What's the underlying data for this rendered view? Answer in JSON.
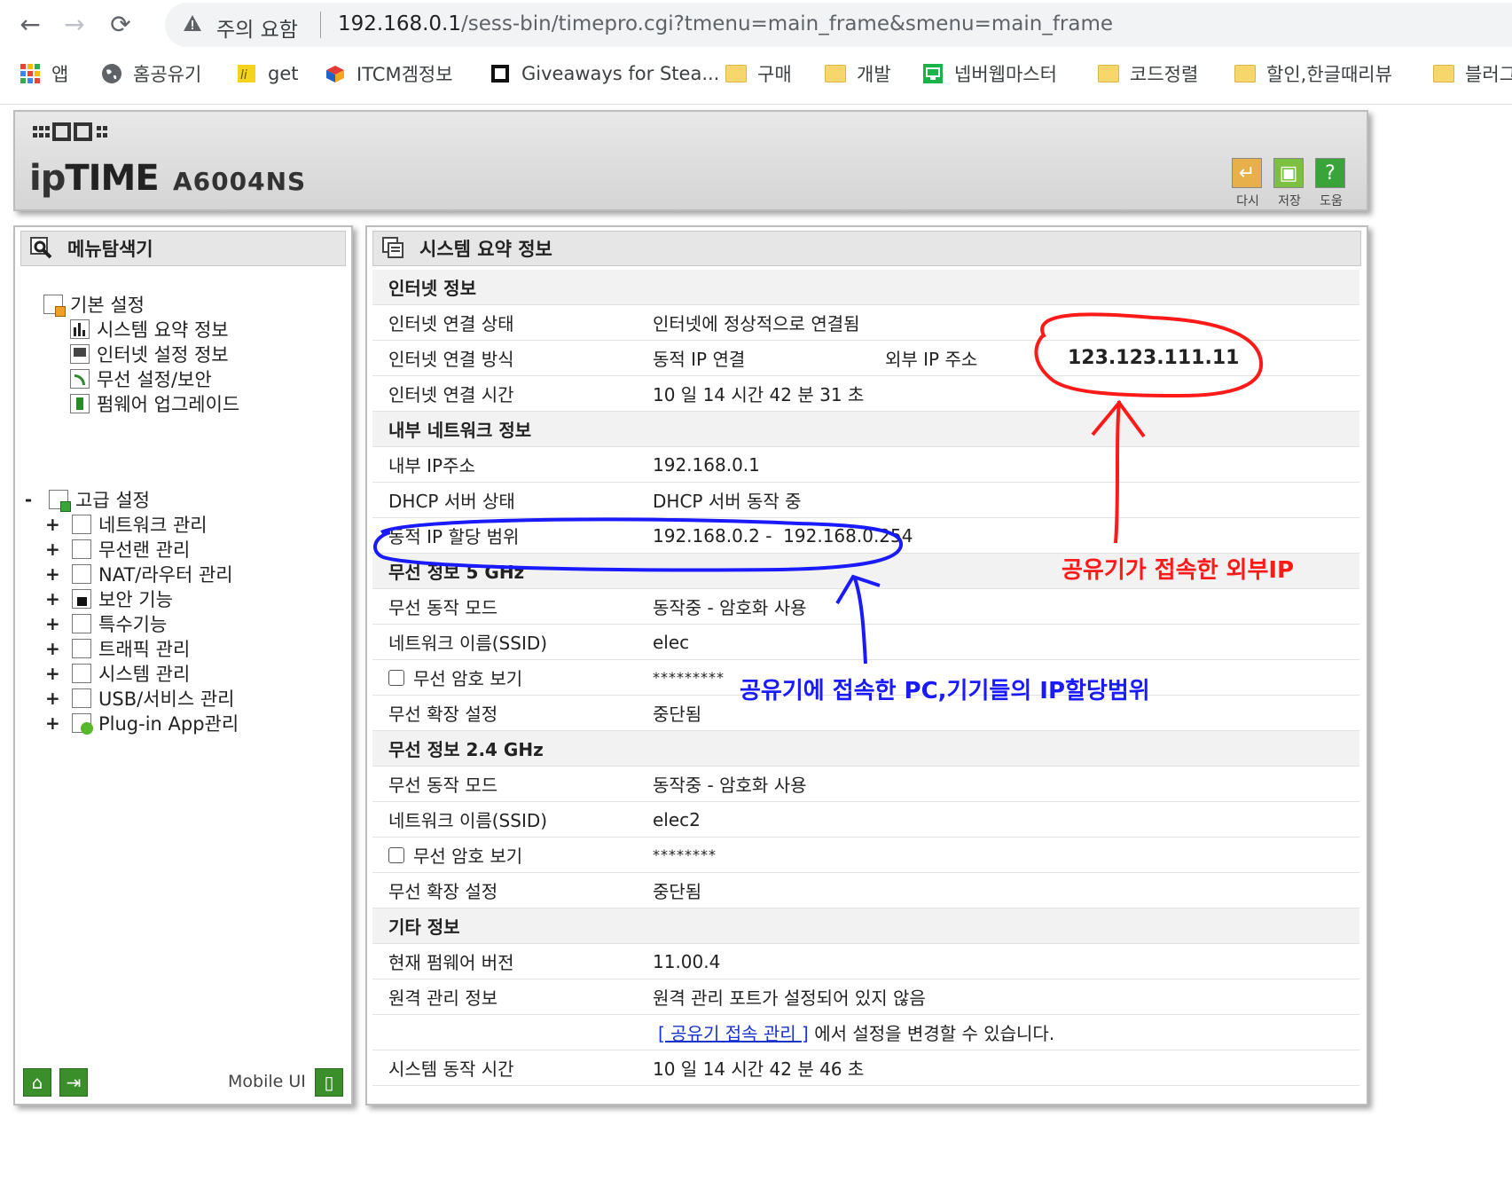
{
  "browser": {
    "nav": {
      "back": "←",
      "forward": "→",
      "reload": "⟳"
    },
    "address": {
      "warning": "주의 요함",
      "host": "192.168.0.1",
      "path": "/sess-bin/timepro.cgi?tmenu=main_frame&smenu=main_frame"
    },
    "bookmarks": [
      {
        "label": "앱",
        "icon": "apps-grid-icon"
      },
      {
        "label": "홈공유기",
        "icon": "globe-icon"
      },
      {
        "label": "get",
        "icon": "bookmark-yellow-icon"
      },
      {
        "label": "ITCM겜정보",
        "icon": "box-icon"
      },
      {
        "label": "Giveaways for Stea...",
        "icon": "square-icon"
      },
      {
        "label": "구매",
        "icon": "folder-icon"
      },
      {
        "label": "개발",
        "icon": "folder-icon"
      },
      {
        "label": "넵버웹마스터",
        "icon": "monitor-icon"
      },
      {
        "label": "코드정렬",
        "icon": "folder-icon"
      },
      {
        "label": "할인,한글때리뷰",
        "icon": "folder-icon"
      },
      {
        "label": "블러그",
        "icon": "folder-icon"
      }
    ]
  },
  "router": {
    "brand_prefix": "ip",
    "brand_suffix": "TIME",
    "model": "A6004NS",
    "header_buttons": [
      {
        "label": "다시",
        "glyph": "↵",
        "color": "#e7b04a"
      },
      {
        "label": "저장",
        "glyph": "▣",
        "color": "#7cc042"
      },
      {
        "label": "도움",
        "glyph": "?",
        "color": "#3aa33a"
      }
    ],
    "menu": {
      "title": "메뉴탐색기",
      "basic_label": "기본 설정",
      "basic_items": [
        "시스템 요약 정보",
        "인터넷 설정 정보",
        "무선 설정/보안",
        "펌웨어 업그레이드"
      ],
      "advanced_toggle": "-",
      "advanced_label": "고급 설정",
      "advanced_items": [
        "네트워크 관리",
        "무선랜 관리",
        "NAT/라우터 관리",
        "보안 기능",
        "특수기능",
        "트래픽 관리",
        "시스템 관리",
        "USB/서비스 관리",
        "Plug-in App관리"
      ],
      "expand_glyph": "+",
      "mobile_label": "Mobile UI"
    },
    "content": {
      "title": "시스템 요약 정보",
      "internet": {
        "section": "인터넷 정보",
        "status_label": "인터넷 연결 상태",
        "status_value": "인터넷에 정상적으로 연결됨",
        "method_label": "인터넷 연결 방식",
        "method_value": "동적 IP 연결",
        "external_ip_label": "외부 IP 주소",
        "external_ip_value": "123.123.111.11",
        "time_label": "인터넷 연결 시간",
        "time_value": "10 일 14 시간 42 분 31 초"
      },
      "lan": {
        "section": "내부 네트워크 정보",
        "ip_label": "내부 IP주소",
        "ip_value": "192.168.0.1",
        "dhcp_label": "DHCP 서버 상태",
        "dhcp_value": "DHCP 서버 동작 중",
        "range_label": "동적 IP 할당 범위",
        "range_value": "192.168.0.2 -  192.168.0.254"
      },
      "wifi5": {
        "section": "무선 정보 5 GHz",
        "mode_label": "무선 동작 모드",
        "mode_value": "동작중 - 암호화 사용",
        "ssid_label": "네트워크 이름(SSID)",
        "ssid_value": "elec",
        "pw_label": "무선 암호 보기",
        "pw_value": "*********",
        "ext_label": "무선 확장 설정",
        "ext_value": "중단됨"
      },
      "wifi24": {
        "section": "무선 정보 2.4 GHz",
        "mode_label": "무선 동작 모드",
        "mode_value": "동작중 - 암호화 사용",
        "ssid_label": "네트워크 이름(SSID)",
        "ssid_value": "elec2",
        "pw_label": "무선 암호 보기",
        "pw_value": "********",
        "ext_label": "무선 확장 설정",
        "ext_value": "중단됨"
      },
      "etc": {
        "section": "기타 정보",
        "fw_label": "현재 펌웨어 버전",
        "fw_value": "11.00.4",
        "remote_label": "원격 관리 정보",
        "remote_value": "원격 관리 포트가 설정되어 있지 않음",
        "remote_link": "[ 공유기 접속 관리 ]",
        "remote_link_suffix": " 에서 설정을 변경할 수 있습니다.",
        "uptime_label": "시스템 동작 시간",
        "uptime_value": "10 일 14 시간 42 분 46 초"
      }
    }
  },
  "annotations": {
    "red_text": "공유기가 접속한 외부IP",
    "blue_text": "공유기에 접속한 PC,기기들의 IP할당범위",
    "red_color": "#ff1a1a",
    "blue_color": "#1a1aff"
  }
}
